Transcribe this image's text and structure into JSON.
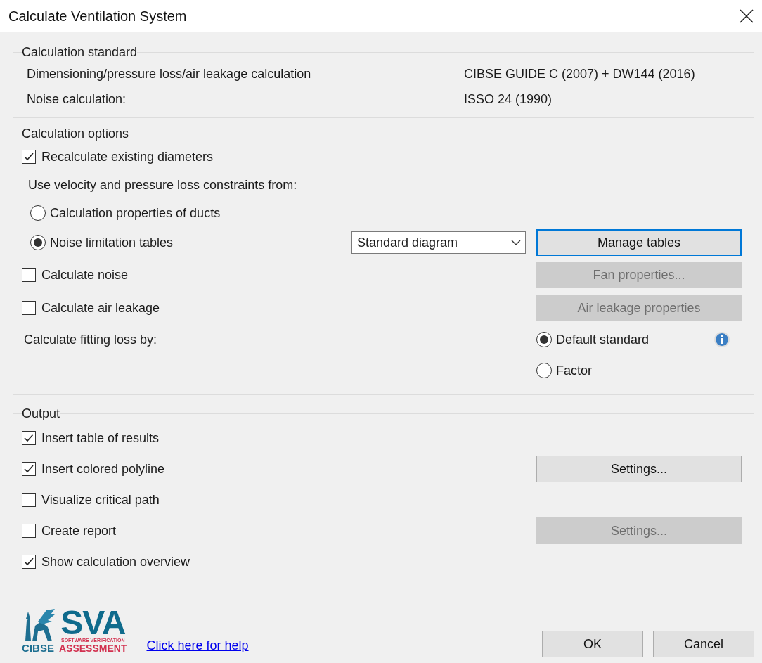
{
  "window": {
    "title": "Calculate Ventilation System"
  },
  "calculation_standard": {
    "legend": "Calculation standard",
    "rows": [
      {
        "label": "Dimensioning/pressure loss/air leakage calculation",
        "value": "CIBSE GUIDE C (2007) + DW144 (2016)"
      },
      {
        "label": "Noise calculation:",
        "value": "ISSO 24 (1990)"
      }
    ]
  },
  "calculation_options": {
    "legend": "Calculation options",
    "recalculate": {
      "label": "Recalculate existing diameters",
      "checked": true
    },
    "constraints_label": "Use velocity and pressure loss constraints from:",
    "constraint_sources": [
      {
        "label": "Calculation properties of ducts",
        "selected": false
      },
      {
        "label": "Noise limitation tables",
        "selected": true
      }
    ],
    "table_select": {
      "value": "Standard diagram"
    },
    "manage_tables_button": {
      "label": "Manage tables",
      "disabled": false,
      "focused": true
    },
    "calculate_noise": {
      "label": "Calculate noise",
      "checked": false
    },
    "fan_properties_button": {
      "label": "Fan properties...",
      "disabled": true,
      "focused": false
    },
    "calculate_air_leakage": {
      "label": "Calculate air leakage",
      "checked": false
    },
    "air_leakage_button": {
      "label": "Air leakage properties",
      "disabled": true,
      "focused": false
    },
    "fitting_loss_label": "Calculate fitting loss by:",
    "fitting_loss_methods": [
      {
        "label": "Default standard",
        "selected": true
      },
      {
        "label": "Factor",
        "selected": false
      }
    ]
  },
  "output": {
    "legend": "Output",
    "items": [
      {
        "label": "Insert table of results",
        "checked": true
      },
      {
        "label": "Insert colored polyline",
        "checked": true,
        "button": {
          "label": "Settings...",
          "disabled": false,
          "focused": false
        }
      },
      {
        "label": "Visualize critical path",
        "checked": false
      },
      {
        "label": "Create report",
        "checked": false,
        "button": {
          "label": "Settings...",
          "disabled": true,
          "focused": false
        }
      },
      {
        "label": "Show calculation overview",
        "checked": true
      }
    ]
  },
  "footer": {
    "logo": {
      "org": "CIBSE",
      "mark": "SVA",
      "tagline": "SOFTWARE VERIFICATION",
      "subtitle": "ASSESSMENT"
    },
    "help_link": "Click here for help",
    "buttons": [
      {
        "label": "OK"
      },
      {
        "label": "Cancel"
      }
    ]
  }
}
